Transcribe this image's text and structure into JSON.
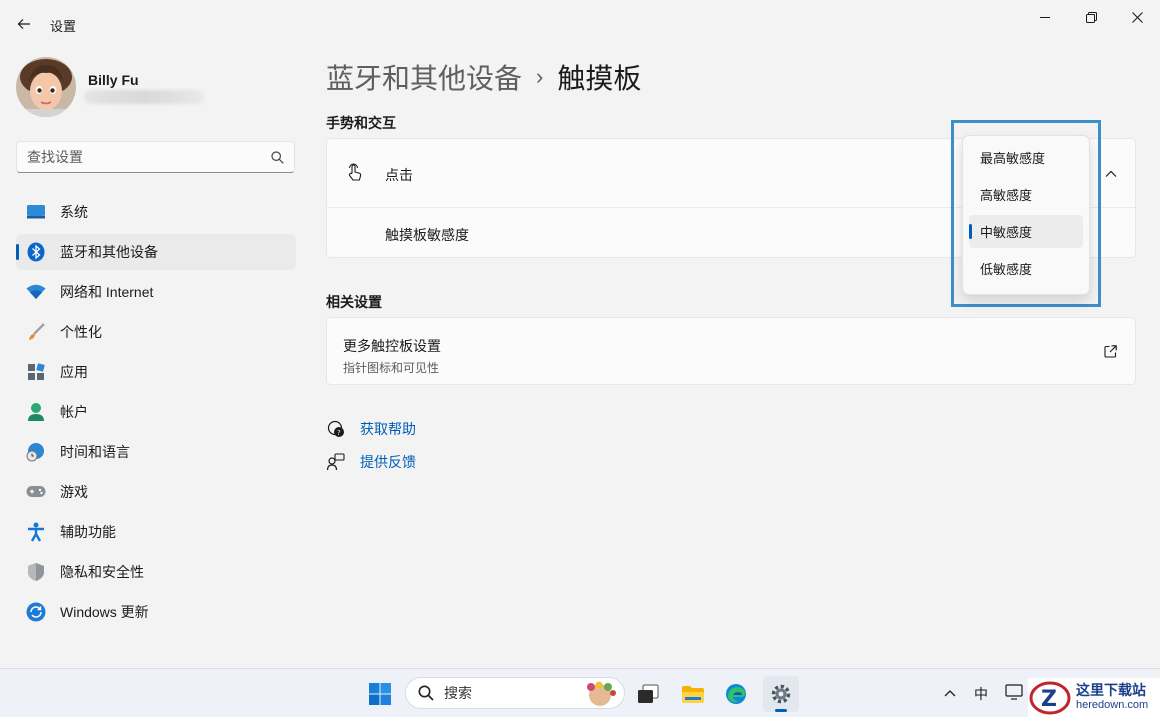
{
  "window": {
    "title": "设置",
    "controls": {
      "minimize": "minimize-icon",
      "maximize": "restore-icon",
      "close": "close-icon"
    }
  },
  "user": {
    "name": "Billy Fu"
  },
  "search": {
    "placeholder": "查找设置"
  },
  "sidebar": {
    "items": [
      {
        "label": "系统",
        "icon": "monitor-icon",
        "active": false
      },
      {
        "label": "蓝牙和其他设备",
        "icon": "bluetooth-icon",
        "active": true
      },
      {
        "label": "网络和 Internet",
        "icon": "wifi-icon",
        "active": false
      },
      {
        "label": "个性化",
        "icon": "brush-icon",
        "active": false
      },
      {
        "label": "应用",
        "icon": "apps-icon",
        "active": false
      },
      {
        "label": "帐户",
        "icon": "person-icon",
        "active": false
      },
      {
        "label": "时间和语言",
        "icon": "globe-clock-icon",
        "active": false
      },
      {
        "label": "游戏",
        "icon": "gamepad-icon",
        "active": false
      },
      {
        "label": "辅助功能",
        "icon": "accessibility-icon",
        "active": false
      },
      {
        "label": "隐私和安全性",
        "icon": "shield-icon",
        "active": false
      },
      {
        "label": "Windows 更新",
        "icon": "update-icon",
        "active": false
      }
    ]
  },
  "breadcrumb": {
    "parent": "蓝牙和其他设备",
    "separator": "›",
    "current": "触摸板"
  },
  "gestures": {
    "section_title": "手势和交互",
    "tap_label": "点击",
    "sensitivity_label": "触摸板敏感度"
  },
  "sensitivity_dropdown": {
    "options": [
      "最高敏感度",
      "高敏感度",
      "中敏感度",
      "低敏感度"
    ],
    "selected": "中敏感度"
  },
  "related": {
    "section_title": "相关设置",
    "more_title": "更多触控板设置",
    "more_subtitle": "指针图标和可见性"
  },
  "links": {
    "help": "获取帮助",
    "feedback": "提供反馈"
  },
  "taskbar": {
    "search_placeholder": "搜索",
    "ime": "中",
    "watermark_title": "这里下载站",
    "watermark_url": "heredown.com"
  },
  "colors": {
    "accent": "#005fb8",
    "frame": "#3d8fcc"
  }
}
